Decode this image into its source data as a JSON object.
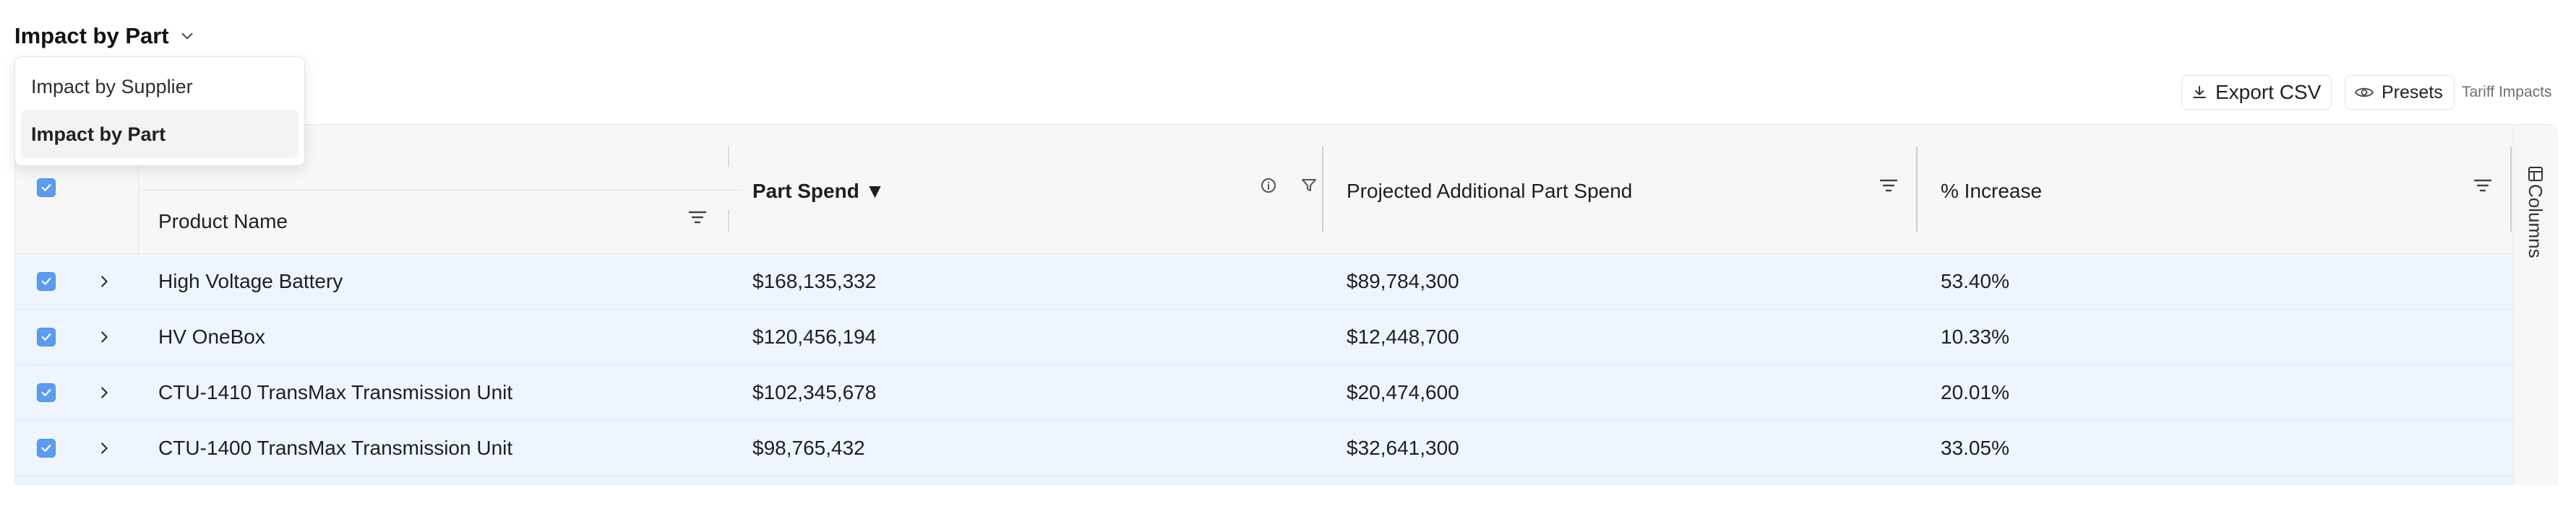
{
  "header": {
    "title": "Impact by Part",
    "view_options": [
      "Impact by Supplier",
      "Impact by Part"
    ],
    "selected_view": "Impact by Part"
  },
  "toolbar": {
    "export_label": "Export CSV",
    "presets_label": "Presets",
    "breadcrumb": "Tariff Impacts"
  },
  "table": {
    "columns": {
      "product": "Product Name",
      "spend": "Part Spend",
      "projected": "Projected Additional Part Spend",
      "increase": "% Increase"
    },
    "sort_indicator": "▼",
    "side_panel_label": "Columns",
    "rows": [
      {
        "name": "High Voltage Battery",
        "spend": "$168,135,332",
        "projected": "$89,784,300",
        "increase": "53.40%"
      },
      {
        "name": "HV OneBox",
        "spend": "$120,456,194",
        "projected": "$12,448,700",
        "increase": "10.33%"
      },
      {
        "name": "CTU-1410 TransMax Transmission Unit",
        "spend": "$102,345,678",
        "projected": "$20,474,600",
        "increase": "20.01%"
      },
      {
        "name": "CTU-1400 TransMax Transmission Unit",
        "spend": "$98,765,432",
        "projected": "$32,641,300",
        "increase": "33.05%"
      }
    ]
  },
  "colors": {
    "accent": "#5b9cf0",
    "row_selected_bg": "#eff5fe",
    "header_bg": "#f7f7f8"
  }
}
